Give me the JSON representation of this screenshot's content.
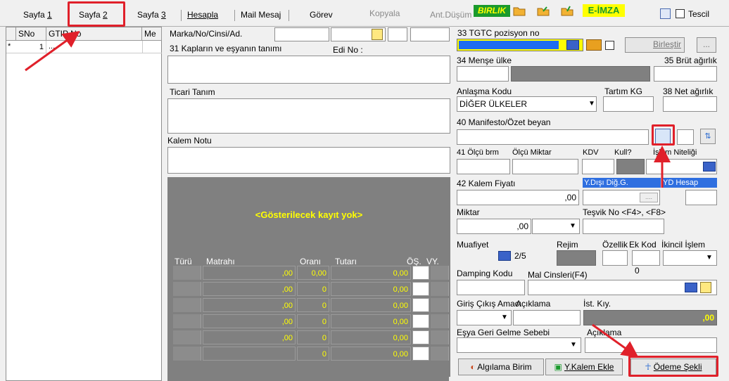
{
  "tabs": [
    {
      "label_pre": "Sayfa ",
      "label_key": "1"
    },
    {
      "label_pre": "Sayfa ",
      "label_key": "2"
    },
    {
      "label_pre": "Sayfa ",
      "label_key": "3"
    }
  ],
  "toolbar": {
    "hesapla": "Hesapla",
    "mail": "Mail Mesaj",
    "gorev": "Görev",
    "kopyala": "Kopyala",
    "ant_dusum": "Ant.Düşüm",
    "birlik": "BIRLIK",
    "eimza": "E-İMZA",
    "tescil": "Tescil"
  },
  "grid": {
    "headers": [
      "SNo",
      "GTIP No",
      "Me"
    ],
    "row_marker": "*",
    "row_sno": "1",
    "row_gtip": "...."
  },
  "mid": {
    "marka_label": "Marka/No/Cinsi/Ad.",
    "kaplar_label": "31 Kapların ve eşyanın tanımı",
    "edi_label": "Edi No :",
    "ticari_label": "Ticari Tanım",
    "kalem_notu_label": "Kalem Notu",
    "no_data": "<Gösterilecek kayıt yok>",
    "tax_headers": [
      "Türü",
      "Matrahı",
      "Oranı",
      "Tutarı",
      "ÖŞ.",
      "VY."
    ],
    "tax_rows": [
      {
        "matrah": ",00",
        "oran": "0,00",
        "tutar": "0,00"
      },
      {
        "matrah": ",00",
        "oran": "0",
        "tutar": "0,00"
      },
      {
        "matrah": ",00",
        "oran": "0",
        "tutar": "0,00"
      },
      {
        "matrah": ",00",
        "oran": "0",
        "tutar": "0,00"
      },
      {
        "matrah": ",00",
        "oran": "0",
        "tutar": "0,00"
      },
      {
        "matrah": "",
        "oran": "0",
        "tutar": "0,00"
      }
    ]
  },
  "right": {
    "tgtc": "33 TGTC pozisyon no",
    "birlestir": "Birleştir",
    "dots": "...",
    "mense": "34 Menşe ülke",
    "brut": "35 Brüt ağırlık",
    "anlasma": "Anlaşma Kodu",
    "tartim": "Tartım KG",
    "net": "38 Net ağırlık",
    "anlasma_value": "DİĞER ÜLKELER",
    "manifesto": "40 Manifesto/Özet beyan",
    "olcu_brm": "41 Ölçü brm",
    "olcu_miktar": "Ölçü Miktar",
    "kdv": "KDV",
    "kull": "Kull?",
    "islem_niteligi": "İşlem Niteliği",
    "kalem_fiyati": "42 Kalem Fiyatı",
    "ydisi": "Y.Dışı Diğ.G.",
    "yd_hesap": "YD Hesap",
    "kalem_fiyati_value": ",00",
    "ydisi_value": "....",
    "miktar": "Miktar",
    "tesvik": "Teşvik No <F4>, <F8>",
    "miktar_value": ",00",
    "muafiyet": "Muafiyet",
    "rejim": "Rejim",
    "ozellik": "Özellik",
    "ek_kod": "Ek Kod",
    "ikincil": "İkincil İşlem",
    "muafiyet_count": "2/5",
    "damping": "Damping Kodu",
    "mal_cinsleri": "Mal Cinsleri(F4)",
    "mal_value": "0",
    "giris_cikis": "Giriş Çıkış Amacı",
    "aciklama": "Açıklama",
    "ist_kiy": "İst. Kıy.",
    "ist_value": ",00",
    "esya_geri": "Eşya Geri Gelme Sebebi",
    "aciklama2": "Açıklama",
    "algilama": "Algılama Birim",
    "ykalem": "Y.Kalem Ekle",
    "odeme": "Ödeme Şekli"
  },
  "colors": {
    "highlight_red": "#e0202a",
    "tgtc_yellow": "#ffff00",
    "tgtc_blue": "#1e6cf0",
    "panel_gray": "#808080",
    "data_yellow": "#ffff00"
  }
}
